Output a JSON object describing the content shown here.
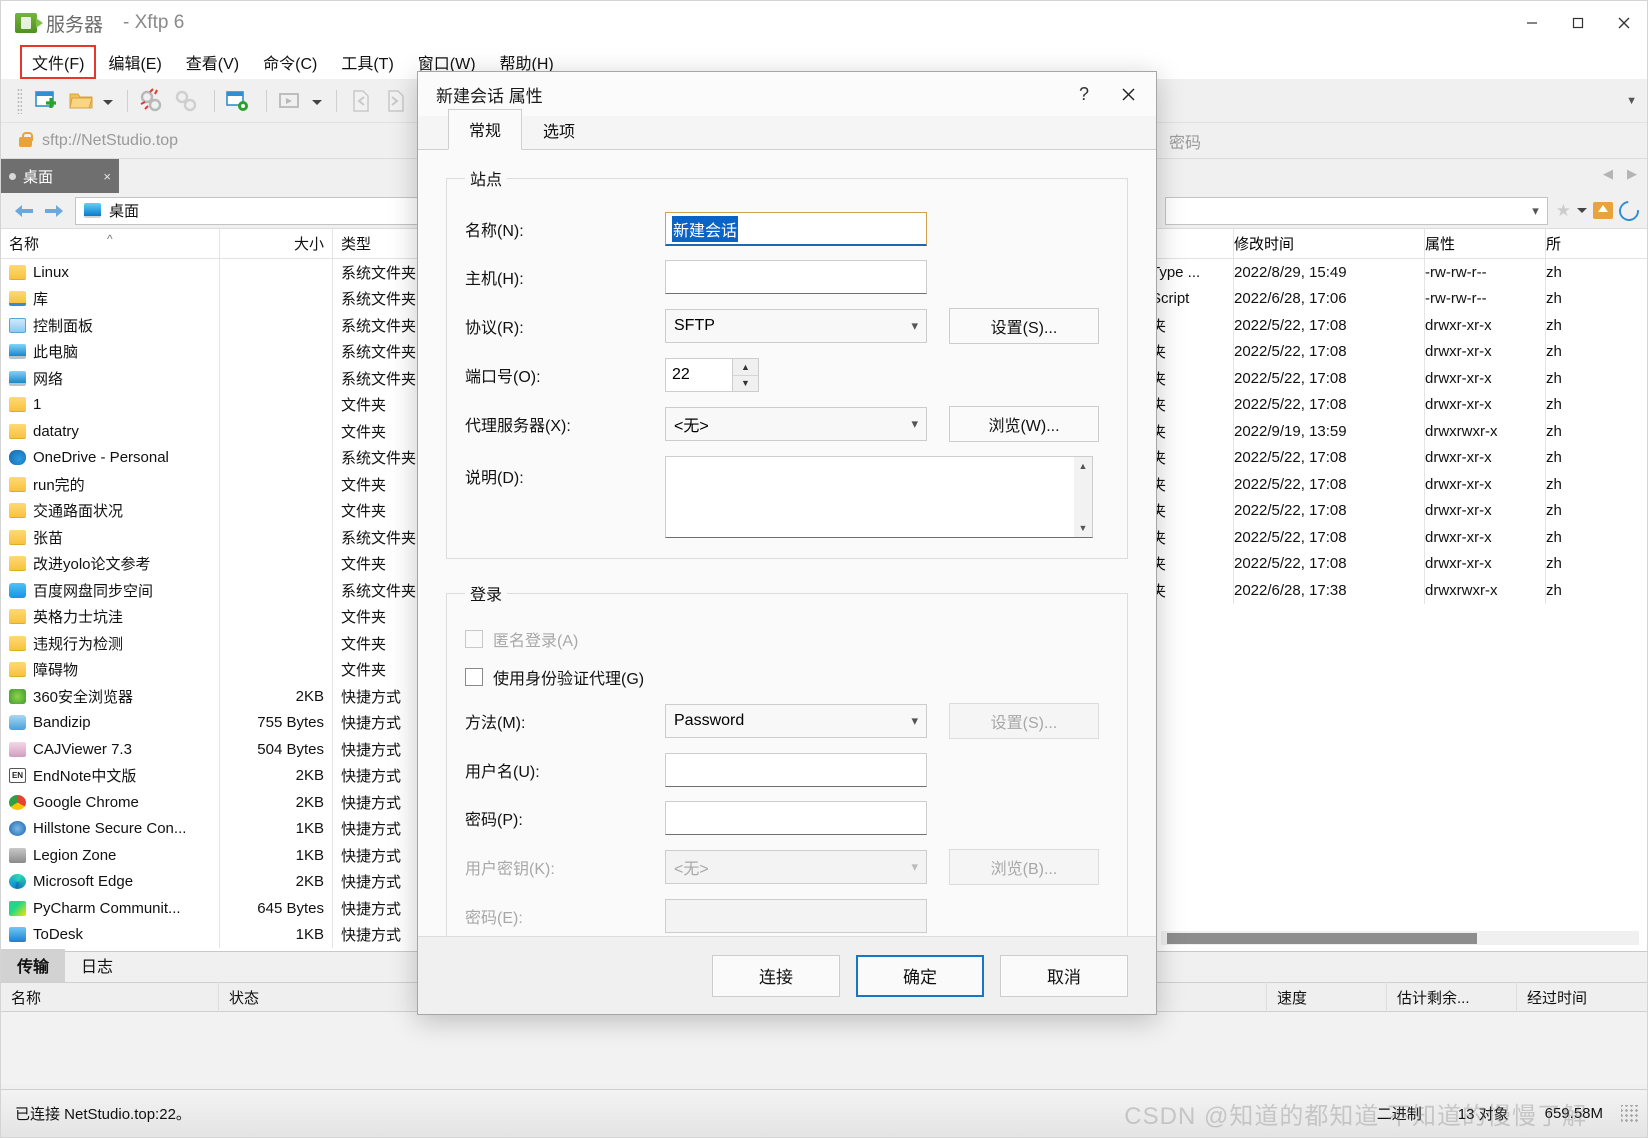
{
  "window": {
    "title": "服务器",
    "app_name": "- Xftp 6",
    "minimize": "—",
    "maximize": "□",
    "close": "✕"
  },
  "menubar": {
    "items": [
      {
        "label": "文件(F)",
        "highlighted": true
      },
      {
        "label": "编辑(E)",
        "highlighted": false
      },
      {
        "label": "查看(V)",
        "highlighted": false
      },
      {
        "label": "命令(C)",
        "highlighted": false
      },
      {
        "label": "工具(T)",
        "highlighted": false
      },
      {
        "label": "窗口(W)",
        "highlighted": false
      },
      {
        "label": "帮助(H)",
        "highlighted": false
      }
    ]
  },
  "address": {
    "url": "sftp://NetStudio.top",
    "password_placeholder": "密码"
  },
  "session_tab": {
    "label": "桌面",
    "close": "×"
  },
  "left_pane": {
    "path": "桌面",
    "columns": [
      "名称",
      "大小",
      "类型"
    ],
    "rows": [
      {
        "name": "Linux",
        "size": "",
        "type": "系统文件夹",
        "icon": "folder-icon"
      },
      {
        "name": "库",
        "size": "",
        "type": "系统文件夹",
        "icon": "library-folder-icon"
      },
      {
        "name": "控制面板",
        "size": "",
        "type": "系统文件夹",
        "icon": "control-panel-icon"
      },
      {
        "name": "此电脑",
        "size": "",
        "type": "系统文件夹",
        "icon": "this-pc-icon"
      },
      {
        "name": "网络",
        "size": "",
        "type": "系统文件夹",
        "icon": "network-icon"
      },
      {
        "name": "1",
        "size": "",
        "type": "文件夹",
        "icon": "folder-icon"
      },
      {
        "name": "datatry",
        "size": "",
        "type": "文件夹",
        "icon": "folder-icon"
      },
      {
        "name": "OneDrive - Personal",
        "size": "",
        "type": "系统文件夹",
        "icon": "onedrive-icon"
      },
      {
        "name": "run完的",
        "size": "",
        "type": "文件夹",
        "icon": "folder-icon"
      },
      {
        "name": "交通路面状况",
        "size": "",
        "type": "文件夹",
        "icon": "folder-icon"
      },
      {
        "name": "张苗",
        "size": "",
        "type": "系统文件夹",
        "icon": "folder-icon"
      },
      {
        "name": "改进yolo论文参考",
        "size": "",
        "type": "文件夹",
        "icon": "folder-icon"
      },
      {
        "name": "百度网盘同步空间",
        "size": "",
        "type": "系统文件夹",
        "icon": "baidu-netdisk-icon"
      },
      {
        "name": "英格力士坑洼",
        "size": "",
        "type": "文件夹",
        "icon": "folder-icon"
      },
      {
        "name": "违规行为检测",
        "size": "",
        "type": "文件夹",
        "icon": "folder-icon"
      },
      {
        "name": "障碍物",
        "size": "",
        "type": "文件夹",
        "icon": "folder-icon"
      },
      {
        "name": "360安全浏览器",
        "size": "2KB",
        "type": "快捷方式",
        "icon": "360-browser-icon"
      },
      {
        "name": "Bandizip",
        "size": "755 Bytes",
        "type": "快捷方式",
        "icon": "bandizip-icon"
      },
      {
        "name": "CAJViewer 7.3",
        "size": "504 Bytes",
        "type": "快捷方式",
        "icon": "cajviewer-icon"
      },
      {
        "name": "EndNote中文版",
        "size": "2KB",
        "type": "快捷方式",
        "icon": "endnote-icon"
      },
      {
        "name": "Google Chrome",
        "size": "2KB",
        "type": "快捷方式",
        "icon": "chrome-icon"
      },
      {
        "name": "Hillstone Secure Con...",
        "size": "1KB",
        "type": "快捷方式",
        "icon": "hillstone-icon"
      },
      {
        "name": "Legion Zone",
        "size": "1KB",
        "type": "快捷方式",
        "icon": "legion-zone-icon"
      },
      {
        "name": "Microsoft Edge",
        "size": "2KB",
        "type": "快捷方式",
        "icon": "edge-icon"
      },
      {
        "name": "PyCharm Communit...",
        "size": "645 Bytes",
        "type": "快捷方式",
        "icon": "pycharm-icon"
      },
      {
        "name": "ToDesk",
        "size": "1KB",
        "type": "快捷方式",
        "icon": "todesk-icon"
      }
    ]
  },
  "right_pane": {
    "columns": [
      "修改时间",
      "属性",
      "所"
    ],
    "rows": [
      {
        "type": "Type ...",
        "modified": "2022/8/29, 15:49",
        "attr": "-rw-rw-r--",
        "owner": "zh"
      },
      {
        "type": "Script",
        "modified": "2022/6/28, 17:06",
        "attr": "-rw-rw-r--",
        "owner": "zh"
      },
      {
        "type": "夹",
        "modified": "2022/5/22, 17:08",
        "attr": "drwxr-xr-x",
        "owner": "zh"
      },
      {
        "type": "夹",
        "modified": "2022/5/22, 17:08",
        "attr": "drwxr-xr-x",
        "owner": "zh"
      },
      {
        "type": "夹",
        "modified": "2022/5/22, 17:08",
        "attr": "drwxr-xr-x",
        "owner": "zh"
      },
      {
        "type": "夹",
        "modified": "2022/5/22, 17:08",
        "attr": "drwxr-xr-x",
        "owner": "zh"
      },
      {
        "type": "夹",
        "modified": "2022/9/19, 13:59",
        "attr": "drwxrwxr-x",
        "owner": "zh"
      },
      {
        "type": "夹",
        "modified": "2022/5/22, 17:08",
        "attr": "drwxr-xr-x",
        "owner": "zh"
      },
      {
        "type": "夹",
        "modified": "2022/5/22, 17:08",
        "attr": "drwxr-xr-x",
        "owner": "zh"
      },
      {
        "type": "夹",
        "modified": "2022/5/22, 17:08",
        "attr": "drwxr-xr-x",
        "owner": "zh"
      },
      {
        "type": "夹",
        "modified": "2022/5/22, 17:08",
        "attr": "drwxr-xr-x",
        "owner": "zh"
      },
      {
        "type": "夹",
        "modified": "2022/5/22, 17:08",
        "attr": "drwxr-xr-x",
        "owner": "zh"
      },
      {
        "type": "夹",
        "modified": "2022/6/28, 17:38",
        "attr": "drwxrwxr-x",
        "owner": "zh"
      }
    ]
  },
  "transfer_panel": {
    "tabs": [
      {
        "label": "传输",
        "active": true
      },
      {
        "label": "日志",
        "active": false
      }
    ],
    "columns_left": [
      "名称",
      "状态"
    ],
    "columns_right": [
      "速度",
      "估计剩余...",
      "经过时间"
    ]
  },
  "statusbar": {
    "connection": "已连接 NetStudio.top:22。",
    "mode": "二进制",
    "objects": "13 对象",
    "size": "659.58M"
  },
  "watermark": "CSDN @知道的都知道 不知道的慢慢了解",
  "dialog": {
    "title": "新建会话 属性",
    "help": "?",
    "close": "✕",
    "tabs": [
      {
        "label": "常规",
        "active": true
      },
      {
        "label": "选项",
        "active": false
      }
    ],
    "site": {
      "legend": "站点",
      "name_label": "名称(N):",
      "name_value": "新建会话",
      "host_label": "主机(H):",
      "host_value": "",
      "protocol_label": "协议(R):",
      "protocol_value": "SFTP",
      "protocol_settings_button": "设置(S)...",
      "port_label": "端口号(O):",
      "port_value": "22",
      "proxy_label": "代理服务器(X):",
      "proxy_value": "<无>",
      "proxy_browse_button": "浏览(W)...",
      "desc_label": "说明(D):",
      "desc_value": ""
    },
    "login": {
      "legend": "登录",
      "anonymous_label": "匿名登录(A)",
      "anonymous_checked": false,
      "agent_label": "使用身份验证代理(G)",
      "agent_checked": false,
      "method_label": "方法(M):",
      "method_value": "Password",
      "method_settings_button": "设置(S)...",
      "username_label": "用户名(U):",
      "username_value": "",
      "password_label": "密码(P):",
      "password_value": "",
      "userkey_label": "用户密钥(K):",
      "userkey_value": "<无>",
      "userkey_browse_button": "浏览(B)...",
      "passphrase_label": "密码(E):",
      "passphrase_value": ""
    },
    "buttons": {
      "connect": "连接",
      "ok": "确定",
      "cancel": "取消"
    }
  }
}
